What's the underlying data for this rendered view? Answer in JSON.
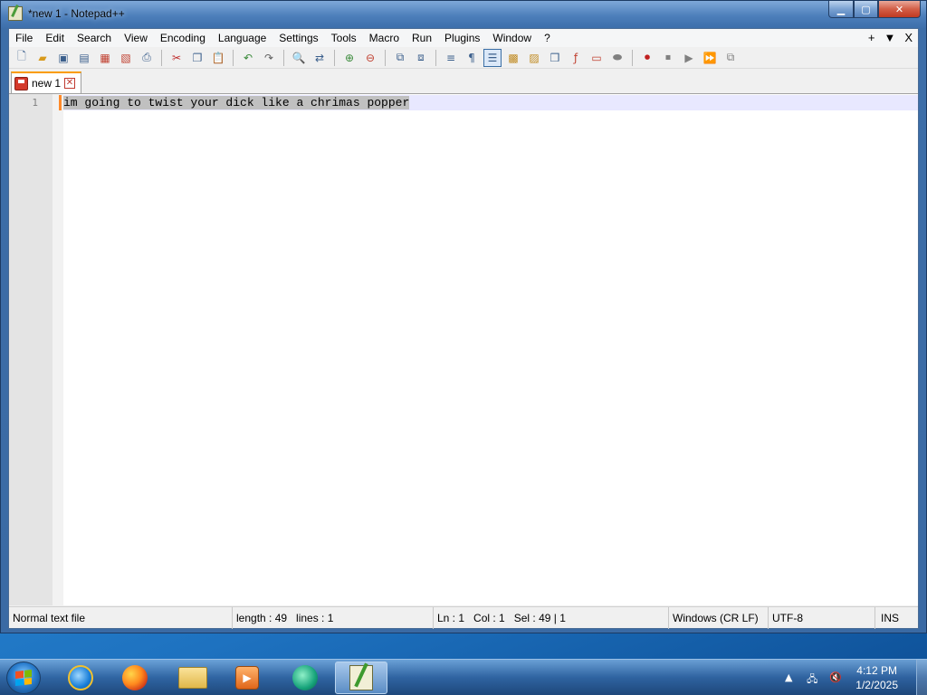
{
  "window": {
    "title": "*new 1 - Notepad++"
  },
  "menu": {
    "items": [
      "File",
      "Edit",
      "Search",
      "View",
      "Encoding",
      "Language",
      "Settings",
      "Tools",
      "Macro",
      "Run",
      "Plugins",
      "Window",
      "?"
    ],
    "right_plus": "+",
    "right_down": "▼",
    "right_close": "X"
  },
  "toolbar": {
    "icons": [
      "new-file-icon",
      "open-file-icon",
      "save-icon",
      "save-all-icon",
      "close-icon",
      "close-all-icon",
      "print-icon",
      "cut-icon",
      "copy-icon",
      "paste-icon",
      "undo-icon",
      "redo-icon",
      "find-icon",
      "replace-icon",
      "zoom-in-icon",
      "zoom-out-icon",
      "sync-vertical-icon",
      "sync-horizontal-icon",
      "word-wrap-icon",
      "show-all-chars-icon",
      "indent-guide-icon",
      "user-lang-icon",
      "doc-map-icon",
      "function-list-icon",
      "folder-workspace-icon",
      "monitoring-icon",
      "record-macro-icon",
      "stop-record-icon",
      "play-macro-icon",
      "run-macro-multiple-icon",
      "save-macro-icon"
    ]
  },
  "tab": {
    "label": "new 1"
  },
  "editor": {
    "line_number": "1",
    "text": "im going to twist your dick like a chrimas popper"
  },
  "status": {
    "file_type": "Normal text file",
    "length": "length : 49",
    "lines": "lines : 1",
    "ln": "Ln : 1",
    "col": "Col : 1",
    "sel": "Sel : 49 | 1",
    "eol": "Windows (CR LF)",
    "encoding": "UTF-8",
    "mode": "INS"
  },
  "taskbar": {
    "apps": [
      "internet-explorer",
      "firefox",
      "file-explorer",
      "media-player",
      "app-green",
      "notepad-plus-plus"
    ],
    "time": "4:12 PM",
    "date": "1/2/2025"
  },
  "colors": {
    "accent": "#fa9c00",
    "selection": "#c0c0c0",
    "current_line": "#e8e8ff"
  }
}
